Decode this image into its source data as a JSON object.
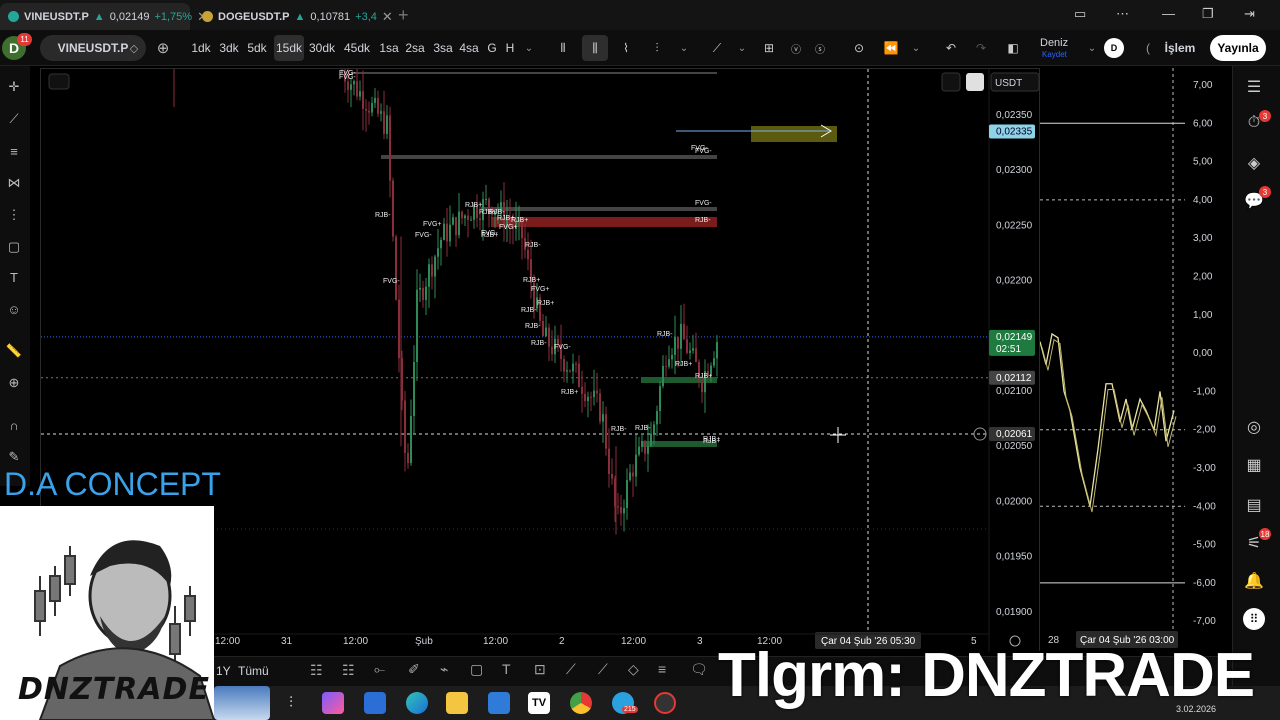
{
  "browser": {
    "tabs": [
      {
        "symbol": "VINEUSDT.P",
        "price": "0,02149",
        "change": "+1,75%",
        "active": true
      },
      {
        "symbol": "DOGEUSDT.P",
        "price": "0,10781",
        "change": "+3,4",
        "active": false
      }
    ]
  },
  "toolbar": {
    "avatar_letter": "D",
    "avatar_badge": "11",
    "symbol": "VINEUSDT.P",
    "intervals": [
      "1dk",
      "3dk",
      "5dk",
      "15dk",
      "30dk",
      "45dk",
      "1sa",
      "2sa",
      "3sa",
      "4sa",
      "G",
      "H"
    ],
    "active_interval": "15dk",
    "user_name": "Deniz",
    "user_save": "Kaydet",
    "user_initial": "D",
    "trade_label": "İşlem",
    "publish_label": "Yayınla"
  },
  "chart": {
    "currency": "USDT",
    "current_price": "0,02149",
    "countdown": "02:51",
    "target_price": "0,02335",
    "level_price": "0,02112",
    "crosshair_price": "0,02061",
    "crosshair_time": "Çar 04 Şub '26   05:30",
    "price_ticks": [
      "0,02350",
      "0,02300",
      "0,02250",
      "0,02200",
      "0,02100",
      "0,02050",
      "0,02000",
      "0,01950",
      "0,01900"
    ],
    "time_ticks": [
      "12:00",
      "31",
      "12:00",
      "Şub",
      "12:00",
      "2",
      "12:00",
      "3",
      "12:00",
      "5"
    ],
    "zone_labels": [
      "FVG-",
      "FVG-",
      "RJB-",
      "RJB+",
      "RJB+",
      "RJB+",
      "FVG+",
      "FVG-",
      "FVG-",
      "RJB-",
      "RJB+",
      "RJB-",
      "RJB-",
      "RJB-",
      "FVG+",
      "RJB+",
      "FVG-",
      "RJB+",
      "RJB-",
      "RJB+",
      "RJB-",
      "RJB+",
      "RJB+",
      "RJB-",
      "FVG+",
      "FVG-",
      "RJB-",
      "RJB+",
      "RJB+",
      "FVG-"
    ]
  },
  "indicator": {
    "ticks": [
      "7,00",
      "6,00",
      "5,00",
      "4,00",
      "3,00",
      "2,00",
      "1,00",
      "0,00",
      "-1,00",
      "-2,00",
      "-3,00",
      "-4,00",
      "-5,00",
      "-6,00",
      "-7,00"
    ],
    "time_label_left": "28",
    "time_label": "Çar 04 Şub '26   03:00"
  },
  "bottom": {
    "range_1y": "1Y",
    "range_all": "Tümü"
  },
  "widgets": {
    "badge_alerts": "3",
    "badge_chat": "3",
    "badge_stream": "18"
  },
  "overlay": {
    "brand_title": "D.A CONCEPT",
    "logo_text": "DNZTRADE",
    "telegram": "Tlgrm: DNZTRADE",
    "tray_date": "3.02.2026",
    "taskbar_badge": "215"
  },
  "colors": {
    "up": "#26a69a",
    "down": "#ef5350",
    "accent_green": "#1e7a3e",
    "brand_blue": "#3aa2e8",
    "indicator_line": "#e8e3a0"
  }
}
